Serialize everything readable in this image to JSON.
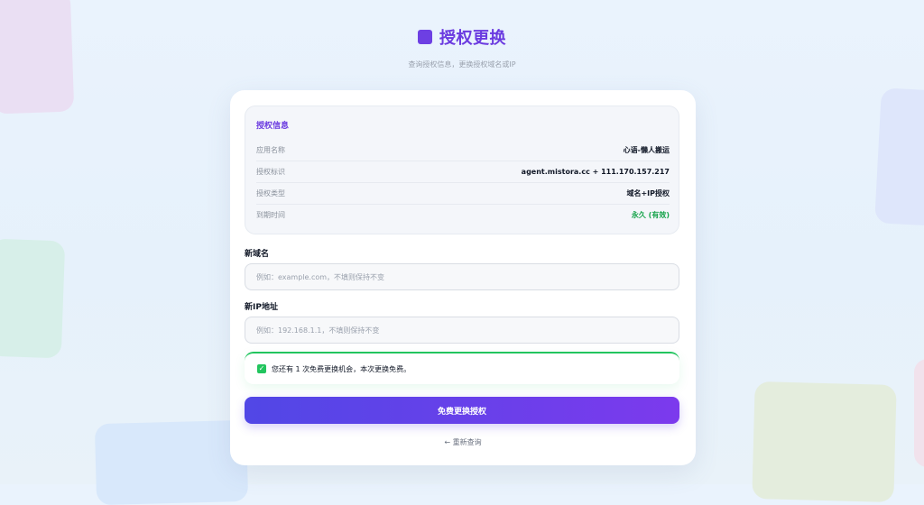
{
  "header": {
    "title": "授权更换",
    "subtitle": "查询授权信息，更换授权域名或IP"
  },
  "info": {
    "title": "授权信息",
    "rows": [
      {
        "label": "应用名称",
        "value": "心语-懒人搬运"
      },
      {
        "label": "授权标识",
        "value": "agent.mistora.cc + 111.170.157.217"
      },
      {
        "label": "授权类型",
        "value": "域名+IP授权"
      },
      {
        "label": "到期时间",
        "value": "永久 (有效)"
      }
    ]
  },
  "form": {
    "domain_label": "新域名",
    "domain_placeholder": "例如：example.com，不填则保持不变",
    "ip_label": "新IP地址",
    "ip_placeholder": "例如：192.168.1.1，不填则保持不变"
  },
  "notice": {
    "text": "您还有 1 次免费更换机会，本次更换免费。"
  },
  "actions": {
    "submit_label": "免费更换授权",
    "back_label": "← 重新查询"
  },
  "colors": {
    "accent": "#6b3be0",
    "success": "#16a34a"
  }
}
